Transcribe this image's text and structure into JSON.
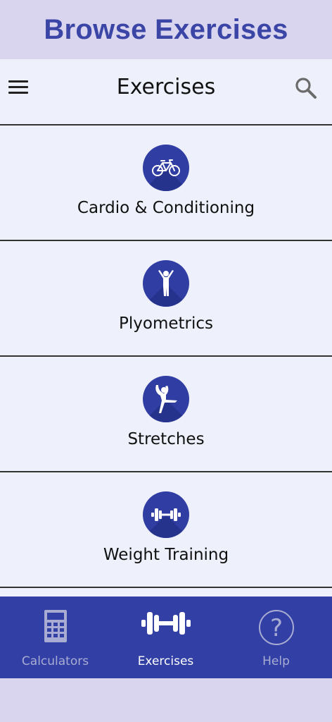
{
  "banner": {
    "title": "Browse Exercises"
  },
  "appbar": {
    "title": "Exercises",
    "menu_icon": "hamburger-menu-icon",
    "search_icon": "search-icon"
  },
  "categories": [
    {
      "label": "Cardio & Conditioning",
      "icon": "bicycle-icon"
    },
    {
      "label": "Plyometrics",
      "icon": "jumping-person-icon"
    },
    {
      "label": "Stretches",
      "icon": "stretching-person-icon"
    },
    {
      "label": "Weight Training",
      "icon": "dumbbell-icon"
    }
  ],
  "bottom_nav": {
    "items": [
      {
        "label": "Calculators",
        "icon": "calculator-icon",
        "active": false
      },
      {
        "label": "Exercises",
        "icon": "dumbbell-icon",
        "active": true
      },
      {
        "label": "Help",
        "icon": "help-icon",
        "active": false
      }
    ]
  },
  "colors": {
    "accent": "#3240a6",
    "banner_text": "#3a45a6",
    "banner_bg": "#d9d5ef",
    "list_bg": "#eef0fb",
    "nav_inactive": "#a9acd2",
    "nav_active": "#ffffff"
  }
}
